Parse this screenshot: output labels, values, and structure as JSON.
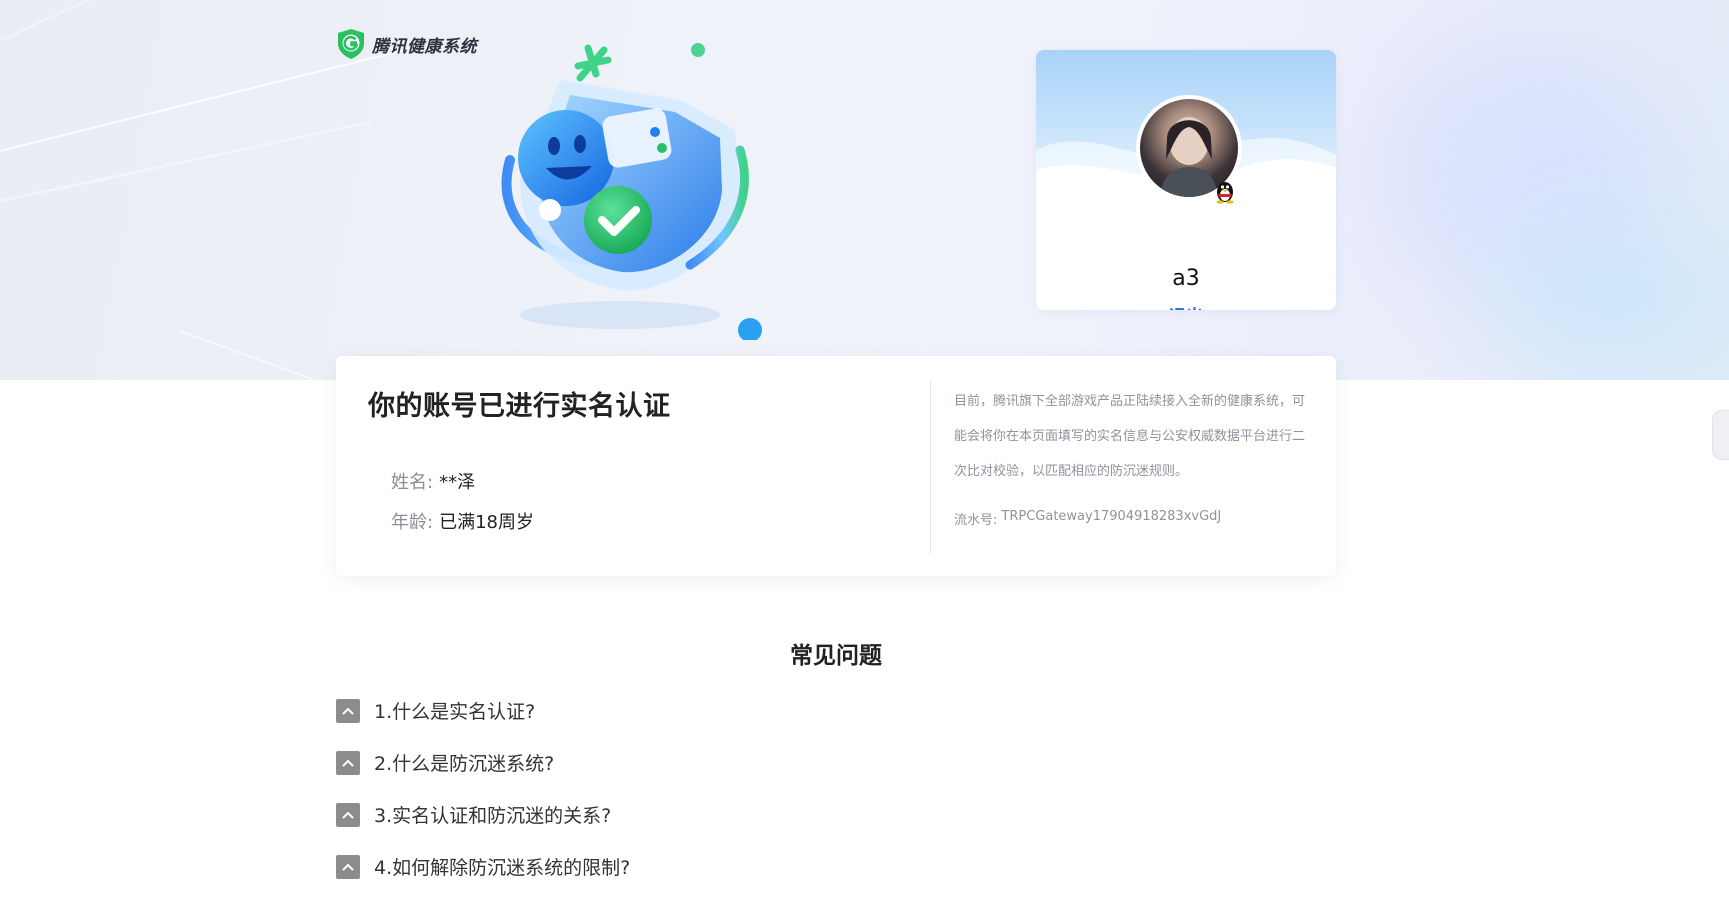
{
  "brand": {
    "name": "腾讯健康系统",
    "icon": "shield-logo-icon"
  },
  "profile": {
    "username": "a3",
    "logout_label": "退出",
    "badge_icon": "qq-penguin-icon"
  },
  "verification": {
    "title": "你的账号已进行实名认证",
    "name_label": "姓名:",
    "name_value": "**泽",
    "age_label": "年龄:",
    "age_value": "已满18周岁",
    "notice": "目前，腾讯旗下全部游戏产品正陆续接入全新的健康系统，可能会将你在本页面填写的实名信息与公安权威数据平台进行二次比对校验，以匹配相应的防沉迷规则。",
    "serial_label": "流水号:",
    "serial_value": "TRPCGateway17904918283xvGdJ"
  },
  "faq": {
    "title": "常见问题",
    "items": [
      {
        "label": "1.什么是实名认证?"
      },
      {
        "label": "2.什么是防沉迷系统?"
      },
      {
        "label": "3.实名认证和防沉迷的关系?"
      },
      {
        "label": "4.如何解除防沉迷系统的限制?"
      }
    ],
    "toggle_icon": "chevron-up-icon"
  },
  "colors": {
    "accent_link": "#1865d6",
    "toggle_bg": "#8c8c8c",
    "shield_green": "#2cc36b",
    "shield_blue": "#2b8cf0"
  }
}
